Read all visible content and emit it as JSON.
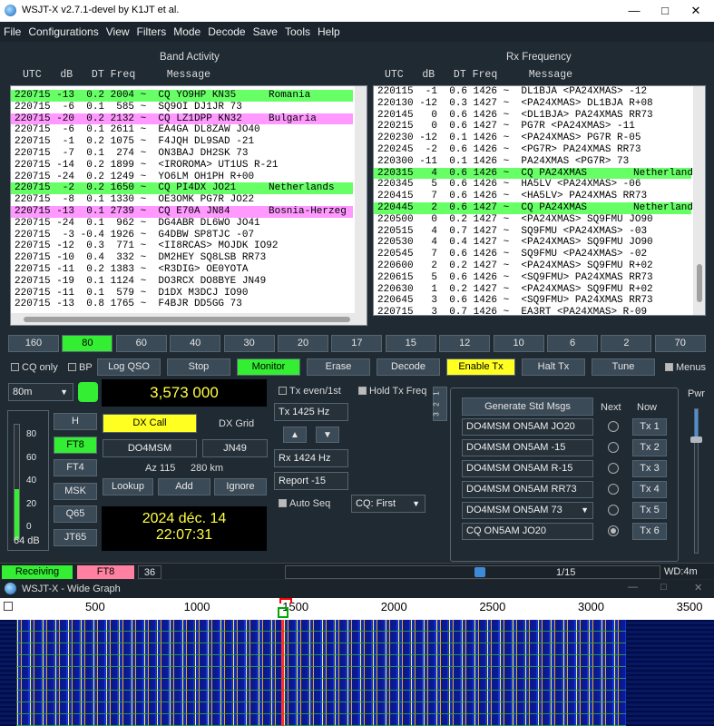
{
  "window": {
    "title": "WSJT-X   v2.7.1-devel   by K1JT et al."
  },
  "menu": [
    "File",
    "Configurations",
    "View",
    "Filters",
    "Mode",
    "Decode",
    "Save",
    "Tools",
    "Help"
  ],
  "band_activity": {
    "title": "Band Activity",
    "columns": "UTC   dB   DT Freq     Message",
    "rows": [
      {
        "text": "220715 -13  0.2 2004 ~  CQ YO9HP KN35",
        "country": "Romania",
        "hl": "g"
      },
      {
        "text": "220715  -6  0.1  585 ~  SQ9OI DJ1JR 73",
        "country": "",
        "hl": ""
      },
      {
        "text": "220715 -20  0.2 2132 ~  CQ LZ1DPP KN32",
        "country": "Bulgaria",
        "hl": "p"
      },
      {
        "text": "220715  -6  0.1 2611 ~  EA4GA DL8ZAW JO40",
        "country": "",
        "hl": ""
      },
      {
        "text": "220715  -1  0.2 1075 ~  F4JQH DL9SAD -21",
        "country": "",
        "hl": ""
      },
      {
        "text": "220715  -7  0.1  274 ~  ON3BAJ DH2SK 73",
        "country": "",
        "hl": ""
      },
      {
        "text": "220715 -14  0.2 1899 ~  <IROROMA> UT1US R-21",
        "country": "",
        "hl": ""
      },
      {
        "text": "220715 -24  0.2 1249 ~  YO6LM OH1PH R+00",
        "country": "",
        "hl": ""
      },
      {
        "text": "220715  -2  0.2 1650 ~  CQ PI4DX JO21",
        "country": "Netherlands",
        "hl": "g"
      },
      {
        "text": "220715  -8  0.1 1330 ~  OE3OMK PG7R JO22",
        "country": "",
        "hl": ""
      },
      {
        "text": "220715 -13  0.1 2739 ~  CQ E70A JN84",
        "country": "Bosnia-Herzeg",
        "hl": "p"
      },
      {
        "text": "220715 -24  0.1  962 ~  DG4ABR DL6WO JO41",
        "country": "",
        "hl": ""
      },
      {
        "text": "220715  -3 -0.4 1926 ~  G4DBW SP8TJC -07",
        "country": "",
        "hl": ""
      },
      {
        "text": "220715 -12  0.3  771 ~  <II8RCAS> MOJDK IO92",
        "country": "",
        "hl": ""
      },
      {
        "text": "220715 -10  0.4  332 ~  DM2HEY SQ8LSB RR73",
        "country": "",
        "hl": ""
      },
      {
        "text": "220715 -11  0.2 1383 ~  <R3DIG> OE0YOTA",
        "country": "",
        "hl": ""
      },
      {
        "text": "220715 -19  0.1 1124 ~  DO3RCX DO8BYE JN49",
        "country": "",
        "hl": ""
      },
      {
        "text": "220715 -11  0.1  579 ~  D1DX M3DCJ IO90",
        "country": "",
        "hl": ""
      },
      {
        "text": "220715 -13  0.8 1765 ~  F4BJR DD5GG 73",
        "country": "",
        "hl": ""
      }
    ]
  },
  "rx_frequency": {
    "title": "Rx Frequency",
    "columns": "UTC   dB   DT Freq     Message",
    "rows": [
      {
        "text": "220115  -1  0.6 1426 ~  DL1BJA <PA24XMAS> -12",
        "country": "",
        "hl": ""
      },
      {
        "text": "220130 -12  0.3 1427 ~  <PA24XMAS> DL1BJA R+08",
        "country": "",
        "hl": ""
      },
      {
        "text": "220145   0  0.6 1426 ~  <DL1BJA> PA24XMAS RR73",
        "country": "",
        "hl": ""
      },
      {
        "text": "220215   0  0.6 1427 ~  PG7R <PA24XMAS> -11",
        "country": "",
        "hl": ""
      },
      {
        "text": "220230 -12  0.1 1426 ~  <PA24XMAS> PG7R R-05",
        "country": "",
        "hl": ""
      },
      {
        "text": "220245  -2  0.6 1426 ~  <PG7R> PA24XMAS RR73",
        "country": "",
        "hl": ""
      },
      {
        "text": "220300 -11  0.1 1426 ~  PA24XMAS <PG7R> 73",
        "country": "",
        "hl": ""
      },
      {
        "text": "220315   4  0.6 1426 ~  CQ PA24XMAS",
        "country": "Netherlands",
        "hl": "g"
      },
      {
        "text": "220345   5  0.6 1426 ~  HA5LV <PA24XMAS> -06",
        "country": "",
        "hl": ""
      },
      {
        "text": "220415   7  0.6 1426 ~  <HA5LV> PA24XMAS RR73",
        "country": "",
        "hl": ""
      },
      {
        "text": "220445   2  0.6 1427 ~  CQ PA24XMAS",
        "country": "Netherland",
        "hl": "g"
      },
      {
        "text": "220500   0  0.2 1427 ~  <PA24XMAS> SQ9FMU JO90",
        "country": "",
        "hl": ""
      },
      {
        "text": "220515   4  0.7 1427 ~  SQ9FMU <PA24XMAS> -03",
        "country": "",
        "hl": ""
      },
      {
        "text": "220530   4  0.4 1427 ~  <PA24XMAS> SQ9FMU JO90",
        "country": "",
        "hl": ""
      },
      {
        "text": "220545   7  0.6 1426 ~  SQ9FMU <PA24XMAS> -02",
        "country": "",
        "hl": ""
      },
      {
        "text": "220600   2  0.2 1427 ~  <PA24XMAS> SQ9FMU R+02",
        "country": "",
        "hl": ""
      },
      {
        "text": "220615   5  0.6 1426 ~  <SQ9FMU> PA24XMAS RR73",
        "country": "",
        "hl": ""
      },
      {
        "text": "220630   1  0.2 1427 ~  <PA24XMAS> SQ9FMU R+02",
        "country": "",
        "hl": ""
      },
      {
        "text": "220645   3  0.6 1426 ~  <SQ9FMU> PA24XMAS RR73",
        "country": "",
        "hl": ""
      },
      {
        "text": "220715   3  0.7 1426 ~  EA3RT <PA24XMAS> R-09",
        "country": "",
        "hl": ""
      }
    ]
  },
  "bands": [
    "160",
    "80",
    "60",
    "40",
    "30",
    "20",
    "17",
    "15",
    "12",
    "10",
    "6",
    "2",
    "70"
  ],
  "active_band": "80",
  "controls": {
    "cq_only": "CQ only",
    "bp": "BP",
    "log_qso": "Log QSO",
    "stop": "Stop",
    "monitor": "Monitor",
    "erase": "Erase",
    "decode": "Decode",
    "enable_tx": "Enable Tx",
    "halt_tx": "Halt Tx",
    "tune": "Tune",
    "menus": "Menus"
  },
  "band_select": "80m",
  "frequency": "3,573 000",
  "meter": {
    "ticks": [
      "80",
      "60",
      "40",
      "20",
      "0"
    ],
    "level_db": "64 dB"
  },
  "modes": [
    "H",
    "FT8",
    "FT4",
    "MSK",
    "Q65",
    "JT65"
  ],
  "active_mode": "FT8",
  "dx": {
    "call_label": "DX Call",
    "grid_label": "DX Grid",
    "call": "DO4MSM",
    "grid": "JN49",
    "az": "Az 115",
    "dist": "280 km",
    "lookup": "Lookup",
    "add": "Add",
    "ignore": "Ignore"
  },
  "clock": {
    "date": "2024 déc. 14",
    "time": "22:07:31"
  },
  "tx_settings": {
    "tx_even": "Tx even/1st",
    "hold_tx": "Hold Tx Freq",
    "tx_hz": "Tx  1425  Hz",
    "rx_hz": "Rx  1424  Hz",
    "report": "Report -15",
    "auto_seq": "Auto Seq",
    "cq_sel": "CQ: First",
    "tabs": [
      "1",
      "2",
      "3"
    ]
  },
  "messages": {
    "generate": "Generate Std Msgs",
    "next": "Next",
    "now": "Now",
    "items": [
      "DO4MSM ON5AM JO20",
      "DO4MSM ON5AM -15",
      "DO4MSM ON5AM R-15",
      "DO4MSM ON5AM RR73",
      "DO4MSM ON5AM 73",
      "CQ ON5AM JO20"
    ],
    "tx_labels": [
      "Tx 1",
      "Tx 2",
      "Tx 3",
      "Tx 4",
      "Tx 5",
      "Tx 6"
    ],
    "selected": 5
  },
  "pwr_label": "Pwr",
  "status": {
    "state": "Receiving",
    "mode": "FT8",
    "num": "36",
    "progress": "1/15",
    "wd": "WD:4m"
  },
  "wide_graph": {
    "title": "WSJT-X - Wide Graph",
    "scale": [
      "500",
      "1000",
      "1500",
      "2000",
      "2500",
      "3000",
      "3500"
    ]
  },
  "colors": {
    "green": "#33ee33",
    "yellow": "#ffff22",
    "pink": "#ff99ff",
    "bg": "#1f2a33"
  }
}
